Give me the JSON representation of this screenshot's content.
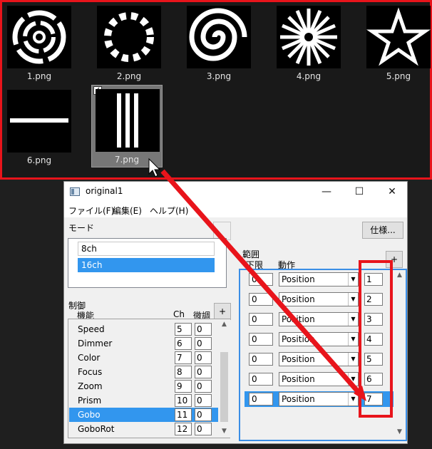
{
  "explorer": {
    "thumbnails": [
      {
        "name": "1.png",
        "icon": "concentric-rings-gobo"
      },
      {
        "name": "2.png",
        "icon": "dotted-ring-gobo"
      },
      {
        "name": "3.png",
        "icon": "spiral-gobo"
      },
      {
        "name": "4.png",
        "icon": "starburst-gobo"
      },
      {
        "name": "5.png",
        "icon": "star-gobo"
      },
      {
        "name": "6.png",
        "icon": "horizontal-line-gobo"
      },
      {
        "name": "7.png",
        "icon": "three-vertical-bars-gobo",
        "selected": true,
        "checked": true
      }
    ]
  },
  "window": {
    "title": "original1",
    "controls": {
      "minimize": "—",
      "maximize": "☐",
      "close": "✕"
    }
  },
  "menu": [
    "ファイル(F)",
    "編集(E)",
    "ヘルプ(H)"
  ],
  "mode": {
    "label": "モード",
    "items": [
      "8ch",
      "16ch"
    ],
    "selected_index": 1
  },
  "spec_button": "仕様...",
  "control": {
    "label": "制御",
    "headers": {
      "name": "機能",
      "ch": "Ch",
      "fine": "微調"
    },
    "add_button": "+",
    "rows": [
      {
        "name": "Speed",
        "ch": "5",
        "fine": "0"
      },
      {
        "name": "Dimmer",
        "ch": "6",
        "fine": "0"
      },
      {
        "name": "Color",
        "ch": "7",
        "fine": "0"
      },
      {
        "name": "Focus",
        "ch": "8",
        "fine": "0"
      },
      {
        "name": "Zoom",
        "ch": "9",
        "fine": "0"
      },
      {
        "name": "Prism",
        "ch": "10",
        "fine": "0"
      },
      {
        "name": "Gobo",
        "ch": "11",
        "fine": "0"
      },
      {
        "name": "GoboRot",
        "ch": "12",
        "fine": "0"
      }
    ],
    "selected_index": 6
  },
  "range": {
    "label": "範囲",
    "headers": {
      "low": "下限",
      "action": "動作"
    },
    "add_button": "+",
    "rows": [
      {
        "low": "0",
        "action": "Position",
        "high": "1"
      },
      {
        "low": "0",
        "action": "Position",
        "high": "2"
      },
      {
        "low": "0",
        "action": "Position",
        "high": "3"
      },
      {
        "low": "0",
        "action": "Position",
        "high": "4"
      },
      {
        "low": "0",
        "action": "Position",
        "high": "5"
      },
      {
        "low": "0",
        "action": "Position",
        "high": "6"
      },
      {
        "low": "0",
        "action": "Position",
        "high": "7"
      }
    ],
    "selected_index": 6
  },
  "colors": {
    "accent": "#3296ee",
    "annotation": "#e8141b"
  }
}
